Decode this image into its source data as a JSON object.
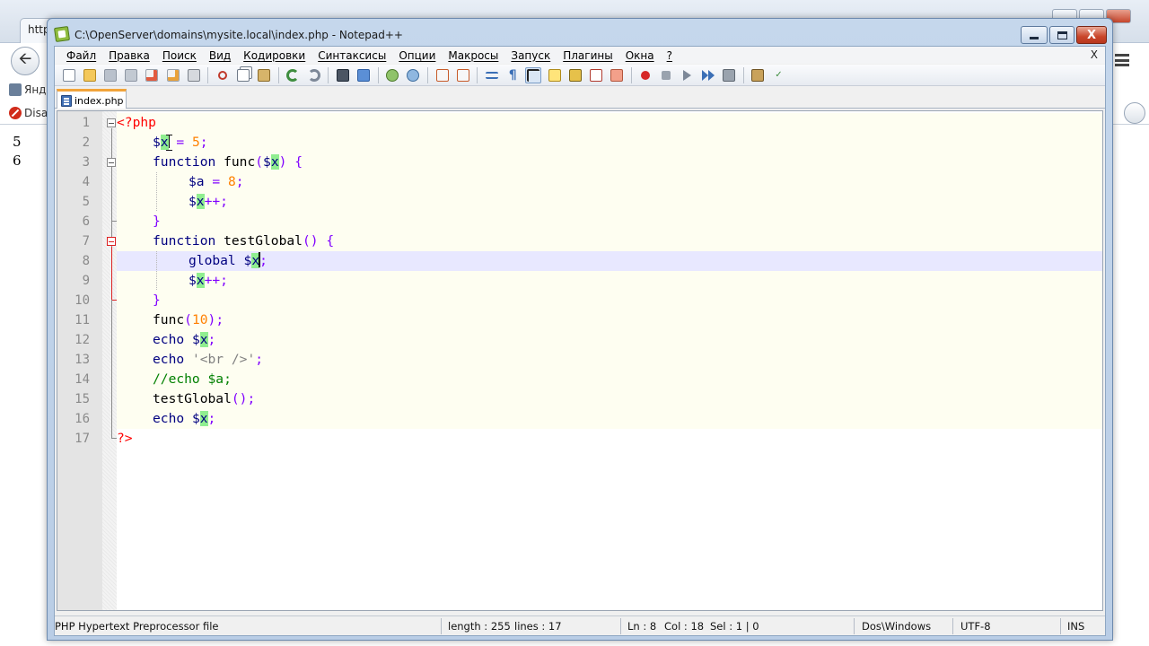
{
  "browser": {
    "tab_text": "http",
    "bookmarks": [
      {
        "label": "Янд"
      },
      {
        "label": "Disab"
      }
    ],
    "output_lines": [
      "5",
      "6"
    ]
  },
  "window": {
    "title": "C:\\OpenServer\\domains\\mysite.local\\index.php - Notepad++",
    "close_glyph": "X"
  },
  "menu": {
    "items": [
      "Файл",
      "Правка",
      "Поиск",
      "Вид",
      "Кодировки",
      "Синтаксисы",
      "Опции",
      "Макросы",
      "Запуск",
      "Плагины",
      "Окна",
      "?"
    ],
    "close_glyph": "X"
  },
  "tab": {
    "label": "index.php"
  },
  "editor": {
    "line_numbers": [
      "1",
      "2",
      "3",
      "4",
      "5",
      "6",
      "7",
      "8",
      "9",
      "10",
      "11",
      "12",
      "13",
      "14",
      "15",
      "16",
      "17"
    ],
    "current_line": 8
  },
  "status": {
    "file_type": "PHP Hypertext Preprocessor file",
    "length": "length : 255",
    "lines": "lines : 17",
    "ln": "Ln : 8",
    "col": "Col : 18",
    "sel": "Sel : 1 | 0",
    "eol": "Dos\\Windows",
    "encoding": "UTF-8",
    "mode": "INS"
  },
  "colors": {
    "keyword": "#000080",
    "php_tag": "#ff0000",
    "operator": "#8000ff",
    "number": "#ff8000",
    "string": "#808080",
    "comment": "#008000",
    "smart_highlight": "#90ee90",
    "current_line": "#e8e8ff",
    "active_tab_accent": "#f2a43a"
  },
  "toolbar_icons": [
    "new-file-icon",
    "open-file-icon",
    "save-icon",
    "save-all-icon",
    "close-icon",
    "close-all-icon",
    "print-icon",
    "cut-icon",
    "copy-icon",
    "paste-icon",
    "undo-icon",
    "redo-icon",
    "find-icon",
    "replace-icon",
    "zoom-in-icon",
    "zoom-out-icon",
    "sync-vertical-icon",
    "sync-horizontal-icon",
    "word-wrap-icon",
    "show-all-chars-icon",
    "indent-guide-icon",
    "user-lang-icon",
    "doc-map-icon",
    "function-list-icon",
    "folder-workspace-icon",
    "record-macro-icon",
    "stop-record-icon",
    "play-macro-icon",
    "run-macro-multiple-icon",
    "save-macro-icon",
    "launch-browser-icon",
    "spell-check-icon"
  ]
}
